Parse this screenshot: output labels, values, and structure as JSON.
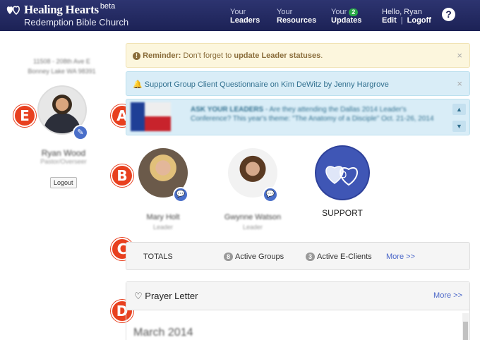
{
  "brand": {
    "name": "Healing Hearts",
    "beta": "beta",
    "church": "Redemption Bible Church"
  },
  "nav": {
    "leaders": {
      "top": "Your",
      "bottom": "Leaders"
    },
    "resources": {
      "top": "Your",
      "bottom": "Resources"
    },
    "updates": {
      "top": "Your",
      "count": "2",
      "bottom": "Updates"
    },
    "account": {
      "greeting": "Hello, Ryan",
      "edit": "Edit",
      "separator": "|",
      "logoff": "Logoff"
    },
    "help": "?"
  },
  "sidebar": {
    "address_line1": "11508 - 208th Ave E",
    "address_line2": "Bonney Lake WA 98391",
    "user_name": "Ryan Wood",
    "user_role": "Pastor/Overseer",
    "logout": "Logout"
  },
  "callouts": {
    "a": "A",
    "b": "B",
    "c": "C",
    "d": "D",
    "e": "E"
  },
  "alerts": {
    "reminder_icon": "!",
    "reminder_label": "Reminder:",
    "reminder_text": " Don't forget to ",
    "reminder_link": "update Leader statuses",
    "reminder_end": ".",
    "info_text": "Support Group Client Questionnaire on Kim DeWitz by Jenny Hargrove",
    "close": "×"
  },
  "carousel": {
    "label": "ASK YOUR LEADERS",
    "text": " - Are they attending the Dallas 2014 Leader's Conference? This year's theme: \"The Anatomy of a Disciple\" Oct. 21-26, 2014"
  },
  "leaders": [
    {
      "name": "Mary Holt",
      "role": "Leader"
    },
    {
      "name": "Gwynne Watson",
      "role": "Leader"
    }
  ],
  "support": {
    "label": "SUPPORT"
  },
  "totals": {
    "label": "TOTALS",
    "groups_count": "8",
    "groups_label": "Active Groups",
    "eclients_count": "3",
    "eclients_label": "Active E-Clients",
    "more": "More >>"
  },
  "prayer": {
    "title": "Prayer Letter",
    "more": "More >>",
    "month": "March 2014"
  },
  "colors": {
    "nav_bg": "#1c2256",
    "accent": "#4a6fc9",
    "callout": "#e8401f",
    "badge_green": "#29a847"
  }
}
